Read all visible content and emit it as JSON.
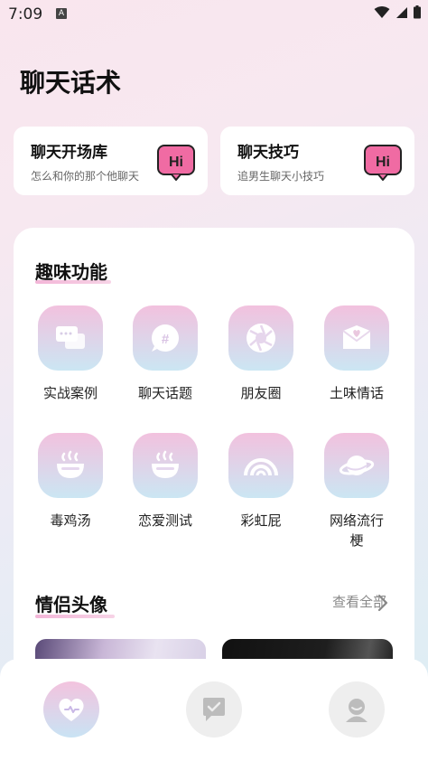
{
  "status": {
    "time": "7:09",
    "badge": "A"
  },
  "page": {
    "title": "聊天话术"
  },
  "cards": [
    {
      "title": "聊天开场库",
      "subtitle": "怎么和你的那个他聊天",
      "badge": "Hi"
    },
    {
      "title": "聊天技巧",
      "subtitle": "追男生聊天小技巧",
      "badge": "Hi"
    }
  ],
  "features": {
    "title": "趣味功能",
    "items": [
      {
        "label": "实战案例",
        "icon": "chat-bubbles-icon"
      },
      {
        "label": "聊天话题",
        "icon": "hashtag-icon"
      },
      {
        "label": "朋友圈",
        "icon": "aperture-icon"
      },
      {
        "label": "土味情话",
        "icon": "love-letter-icon"
      },
      {
        "label": "毒鸡汤",
        "icon": "soup-bowl-icon"
      },
      {
        "label": "恋爱测试",
        "icon": "soup-bowl-icon"
      },
      {
        "label": "彩虹屁",
        "icon": "rainbow-icon"
      },
      {
        "label": "网络流行梗",
        "icon": "planet-icon"
      }
    ]
  },
  "avatars": {
    "title": "情侣头像",
    "more": "查看全部"
  },
  "tabs": [
    {
      "icon": "heart-icon",
      "active": true
    },
    {
      "icon": "chat-check-icon",
      "active": false
    },
    {
      "icon": "profile-icon",
      "active": false
    }
  ],
  "colors": {
    "accent": "#f06ba3",
    "icon_top": "#f2c1de",
    "icon_bottom": "#cbe6f3"
  }
}
